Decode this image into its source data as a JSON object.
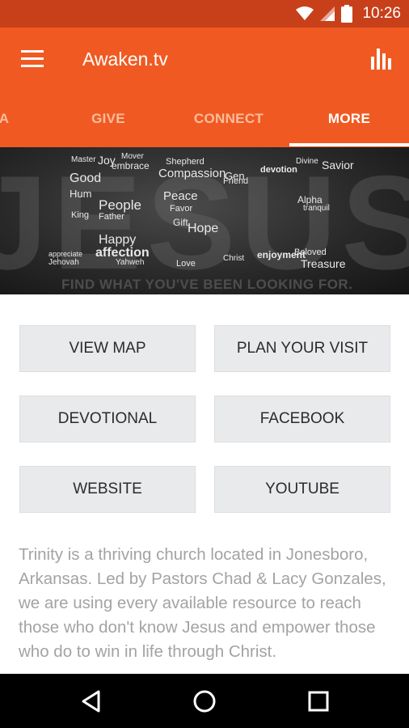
{
  "status_bar": {
    "time": "10:26",
    "icons": [
      "wifi-icon",
      "cell-signal-icon",
      "battery-icon"
    ]
  },
  "app_bar": {
    "title": "Awaken.tv",
    "menu_icon": "hamburger-menu-icon",
    "action_icon": "bar-chart-icon",
    "color": "#f05a22"
  },
  "tabs": [
    {
      "label": "A",
      "active": false
    },
    {
      "label": "GIVE",
      "active": false
    },
    {
      "label": "CONNECT",
      "active": false
    },
    {
      "label": "MORE",
      "active": true
    }
  ],
  "banner": {
    "letters": "JESUS",
    "tagline": "FIND WHAT YOU'VE BEEN LOOKING FOR.",
    "words": [
      "Master",
      "Good",
      "Hum",
      "King",
      "Joy",
      "embrace",
      "Mover",
      "People",
      "Father",
      "Happy",
      "affection",
      "Yahweh",
      "Jehovah",
      "appreciate",
      "Shepherd",
      "Compassion",
      "Peace",
      "Favor",
      "Gift",
      "Hope",
      "Love",
      "Christ",
      "Friend",
      "Savior",
      "enjoyment",
      "devotion",
      "Gen",
      "Alpha",
      "tranquil",
      "Beloved",
      "Treasure",
      "Divine"
    ]
  },
  "buttons": {
    "view_map": "VIEW MAP",
    "plan_your_visit": "PLAN YOUR VISIT",
    "devotional": "DEVOTIONAL",
    "facebook": "FACEBOOK",
    "website": "WEBSITE",
    "youtube": "YOUTUBE"
  },
  "description": "Trinity is a thriving church located in Jonesboro, Arkansas.  Led by Pastors Chad & Lacy Gonzales, we are using every available resource to reach those who don't know Jesus and empower those who do to win in life through Christ.",
  "nav_bar": {
    "icons": [
      "back-icon",
      "home-icon",
      "recents-icon"
    ]
  }
}
